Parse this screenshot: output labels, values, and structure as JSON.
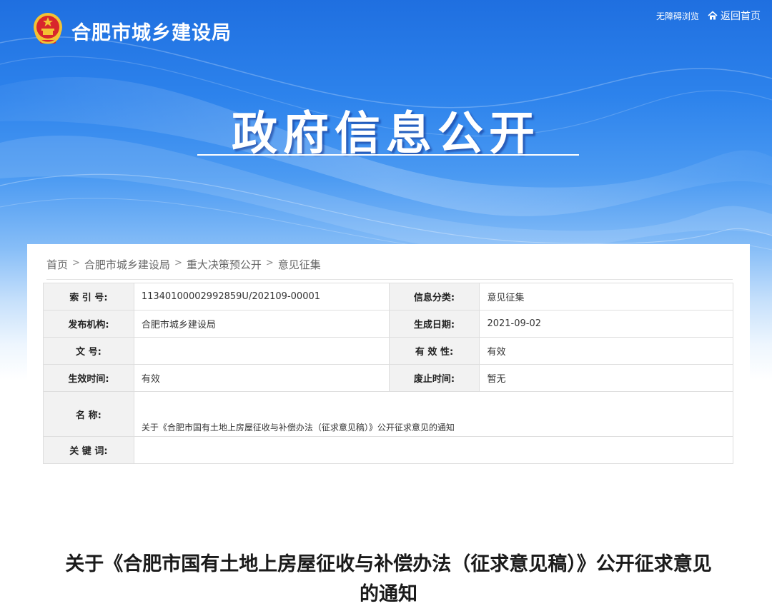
{
  "site": {
    "name": "合肥市城乡建设局",
    "accessibility_label": "无障碍浏览",
    "home_label": "返回首页"
  },
  "hero": {
    "title": "政府信息公开"
  },
  "breadcrumb": [
    "首页",
    "合肥市城乡建设局",
    "重大决策预公开",
    "意见征集"
  ],
  "breadcrumb_separator": ">",
  "meta": {
    "index_label": "索 引 号:",
    "index_value": "11340100002992859U/202109-00001",
    "category_label": "信息分类:",
    "category_value": "意见征集",
    "publisher_label": "发布机构:",
    "publisher_value": "合肥市城乡建设局",
    "date_label": "生成日期:",
    "date_value": "2021-09-02",
    "docno_label": "文 号:",
    "docno_value": "",
    "validity_label": "有 效 性:",
    "validity_value": "有效",
    "effective_label": "生效时间:",
    "effective_value": "有效",
    "repeal_label": "废止时间:",
    "repeal_value": "暂无",
    "name_label": "名 称:",
    "name_value": "关于《合肥市国有土地上房屋征收与补偿办法（征求意见稿）》公开征求意见的通知",
    "keywords_label": "关 键 词:",
    "keywords_value": ""
  },
  "document": {
    "title": "关于《合肥市国有土地上房屋征收与补偿办法（征求意见稿）》公开征求意见的通知"
  },
  "colors": {
    "banner_top": "#1f6fe0",
    "banner_mid": "#4b9af2",
    "label_bg": "#f2f2f2"
  },
  "icons": {
    "emblem": "national-emblem-icon",
    "home": "home-icon"
  }
}
